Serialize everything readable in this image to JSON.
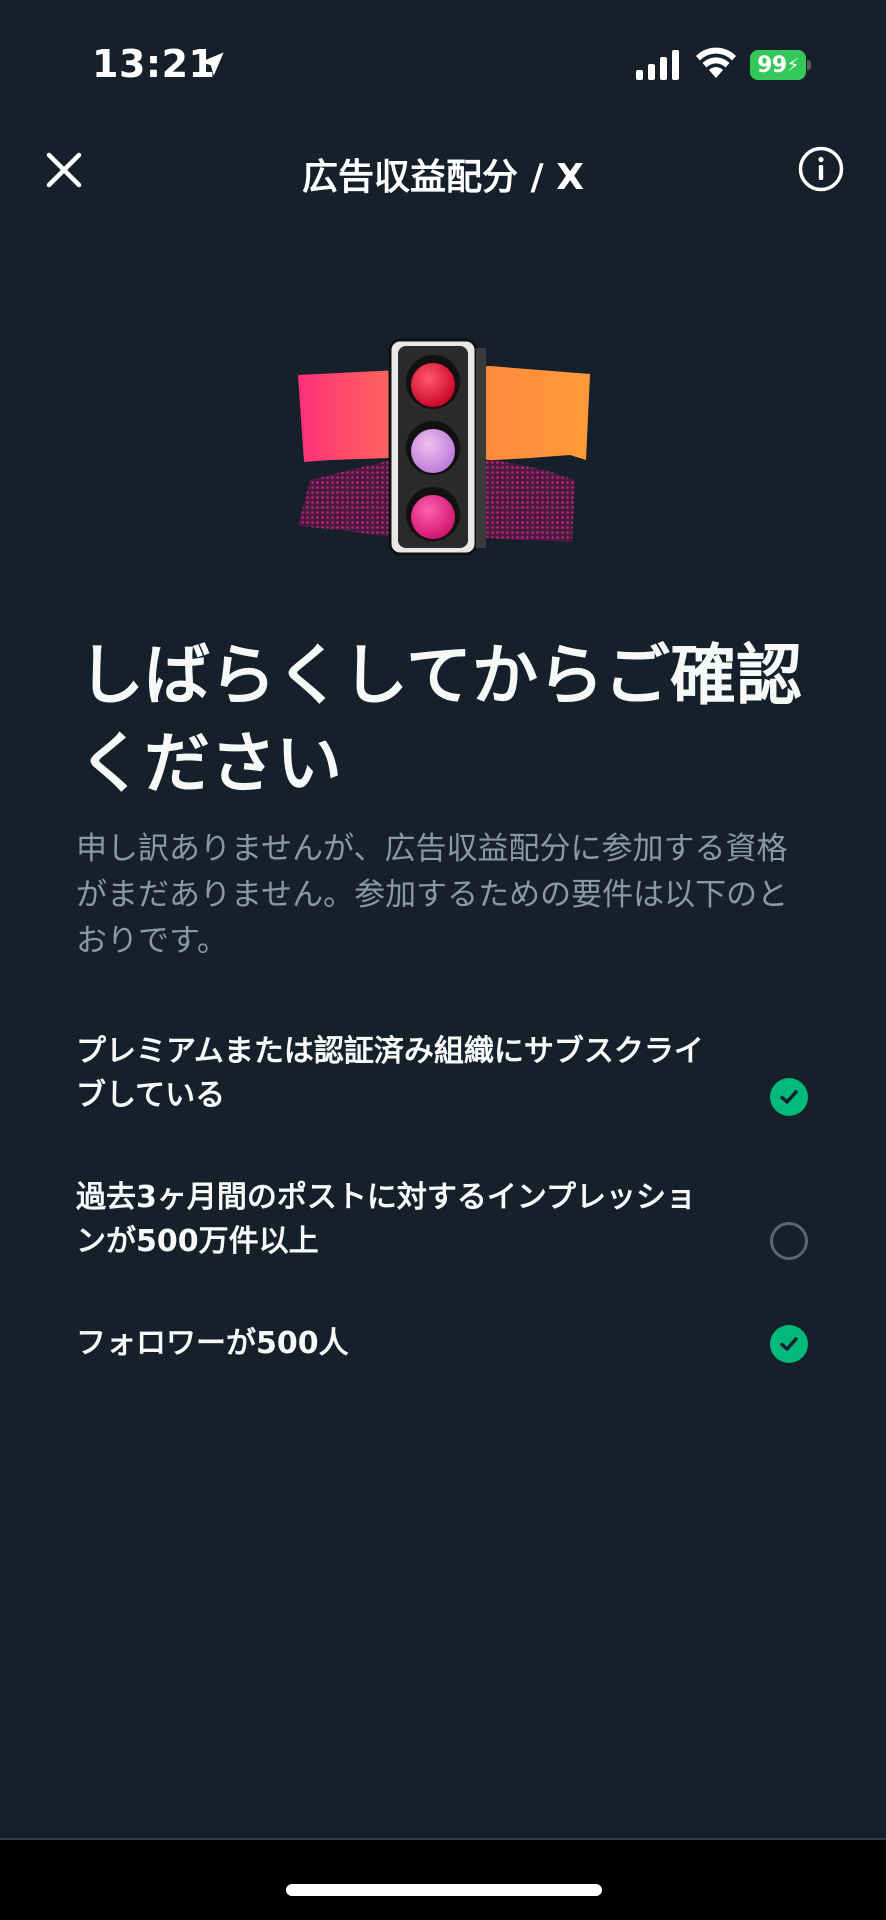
{
  "status_bar": {
    "time": "13:21",
    "battery_level": "99",
    "battery_color": "#34c759",
    "icons": [
      "location-arrow-icon",
      "cellular-signal-icon",
      "wifi-icon",
      "battery-charging-icon"
    ]
  },
  "nav": {
    "title": "広告収益配分 / X",
    "close_icon": "close-icon",
    "info_icon": "info-icon"
  },
  "main": {
    "heading_line1": "しばらくしてからご確認",
    "heading_line2": "ください",
    "description_line1": "申し訳ありませんが、広告収益配分に参加する資格",
    "description_line2": "がまだありません。参加するための要件は以下のと",
    "description_line3": "おりです。"
  },
  "requirements": [
    {
      "line1": "プレミアムまたは認証済み組織にサブスクライ",
      "line2": "ブしている",
      "met": true
    },
    {
      "line1": "過去3ヶ月間のポストに対するインプレッショ",
      "line2": "ンが500万件以上",
      "met": false
    },
    {
      "line1": "フォロワーが500人",
      "line2": "",
      "met": true
    }
  ],
  "colors": {
    "background": "#15202b",
    "check_green": "#00ba7c",
    "secondary_text": "#8b98a5"
  }
}
